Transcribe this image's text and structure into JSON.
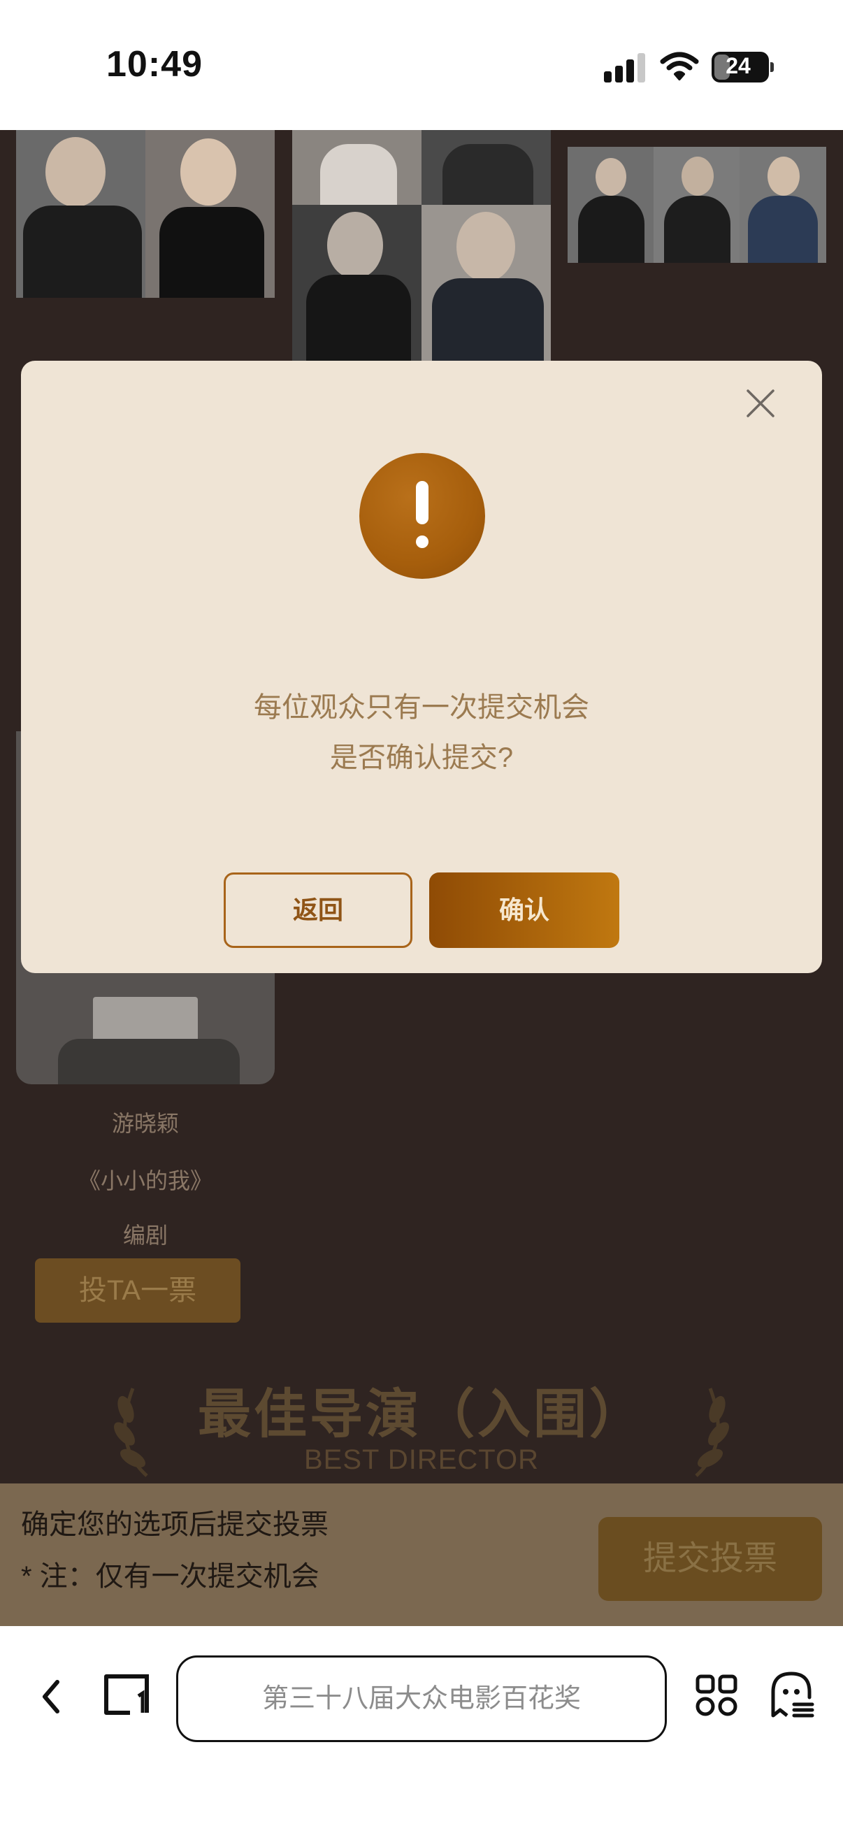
{
  "status_bar": {
    "time": "10:49",
    "battery_level": "24",
    "icons": [
      "cellular-signal-icon",
      "wifi-icon",
      "battery-icon"
    ]
  },
  "background": {
    "nominee": {
      "name": "游晓颖",
      "film": "《小小的我》",
      "role": "编剧",
      "vote_label": "投TA一票"
    },
    "section": {
      "title": "最佳导演（入围）",
      "subtitle": "BEST DIRECTOR"
    },
    "submit_bar": {
      "line1": "确定您的选项后提交投票",
      "line2": "* 注：仅有一次提交机会",
      "button_label": "提交投票"
    }
  },
  "modal": {
    "icon": "exclamation-icon",
    "line1": "每位观众只有一次提交机会",
    "line2": "是否确认提交?",
    "back_label": "返回",
    "confirm_label": "确认",
    "close_icon": "close-icon"
  },
  "browser_toolbar": {
    "url_text": "第三十八届大众电影百花奖",
    "icons": [
      "back-arrow-icon",
      "tabs-icon",
      "apps-grid-icon",
      "ghost-menu-icon"
    ]
  },
  "colors": {
    "modal_bg": "#efe4d5",
    "accent": "#a65e0c",
    "page_bg": "#2f2421"
  }
}
